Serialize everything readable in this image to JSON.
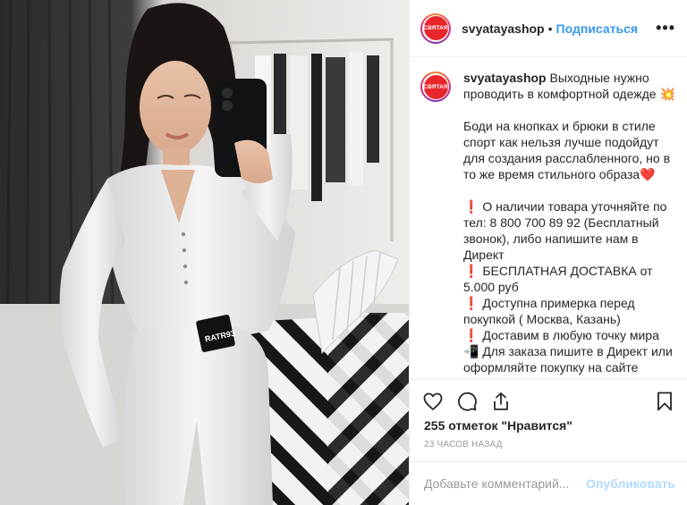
{
  "post": {
    "username": "svyatayashop",
    "avatar_text": "СВЯТАЯ",
    "separator": "•",
    "follow_label": "Подписаться",
    "more_label": "•••"
  },
  "photo": {
    "waistband_text": "RATR93"
  },
  "caption": {
    "username": "svyatayashop",
    "line1": "Выходные нужно проводить в комфортной одежде",
    "emoji1": "💥",
    "para2": "Боди на кнопках и брюки в стиле спорт как нельзя лучше подойдут для создания расслабленного, но в то же время стильного образа",
    "emoji2": "❤️",
    "mark": "❗",
    "item1": "О наличии товара уточняйте по тел: 8 800 700 89 92 (Бесплатный звонок), либо напишите нам в Директ",
    "item2": "БЕСПЛАТНАЯ ДОСТАВКА от 5.000 руб",
    "item3": "Доступна примерка перед покупкой ( Москва, Казань)",
    "item4": "Доставим в любую точку мира",
    "emoji3": "📲",
    "item5": "Для заказа пишите в Директ или оформляйте покупку на сайте"
  },
  "actions": {
    "like": "heart-icon",
    "comment": "comment-icon",
    "share": "share-icon",
    "save": "bookmark-icon"
  },
  "likes_text": "255 отметок \"Нравится\"",
  "time_text": "23 часов назад",
  "comment_box": {
    "placeholder": "Добавьте комментарий...",
    "publish_label": "Опубликовать"
  },
  "colors": {
    "accent": "#3897f0",
    "publish_disabled": "#b3dbff",
    "brand_red": "#e8262b"
  }
}
